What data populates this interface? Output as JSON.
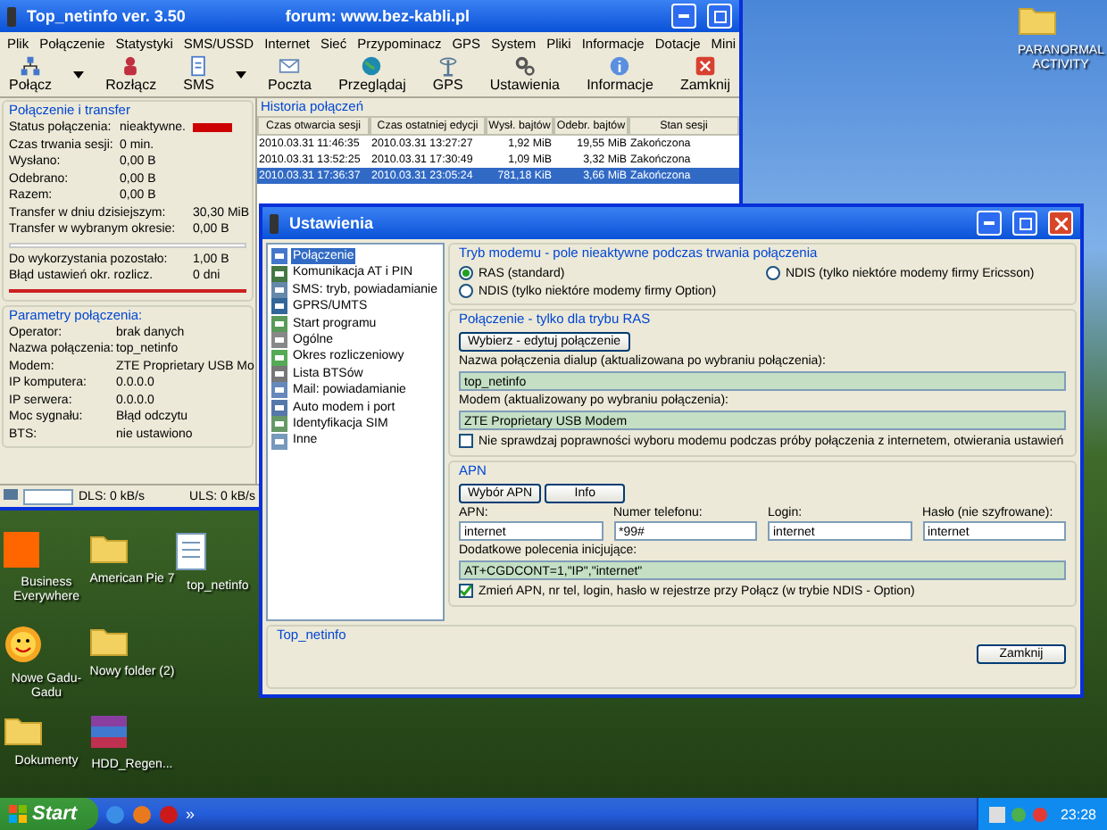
{
  "desktop_icons": [
    {
      "label": "PARANORMAL ACTIVITY",
      "kind": "folder"
    },
    {
      "label": "Business Everywhere",
      "kind": "app"
    },
    {
      "label": "American Pie 7",
      "kind": "folder"
    },
    {
      "label": "top_netinfo",
      "kind": "document"
    },
    {
      "label": "Nowe Gadu-Gadu",
      "kind": "smiley"
    },
    {
      "label": "Nowy folder (2)",
      "kind": "folder"
    },
    {
      "label": "Dokumenty",
      "kind": "folder"
    },
    {
      "label": "HDD_Regen...",
      "kind": "archive"
    }
  ],
  "main_window": {
    "title": "Top_netinfo ver. 3.50",
    "forum": "forum: www.bez-kabli.pl",
    "menu": [
      "Plik",
      "Połączenie",
      "Statystyki",
      "SMS/USSD",
      "Internet",
      "Sieć",
      "Przypominacz",
      "GPS",
      "System",
      "Pliki",
      "Informacje",
      "Dotacje",
      "Mini"
    ],
    "toolbar": [
      {
        "label": "Połącz",
        "dropdown": true
      },
      {
        "label": "Rozłącz",
        "dropdown": false
      },
      {
        "label": "SMS",
        "dropdown": true
      },
      {
        "label": "Poczta",
        "dropdown": false
      },
      {
        "label": "Przeglądaj",
        "dropdown": false
      },
      {
        "label": "GPS",
        "dropdown": false
      },
      {
        "label": "Ustawienia",
        "dropdown": false
      },
      {
        "label": "Informacje",
        "dropdown": false
      },
      {
        "label": "Zamknij",
        "dropdown": false
      }
    ],
    "connection": {
      "title": "Połączenie i transfer",
      "rows": [
        {
          "label": "Status połączenia:",
          "value": "nieaktywne.",
          "color": "#cc0000"
        },
        {
          "label": "Czas trwania sesji:",
          "value": "0 min."
        },
        {
          "label": "Wysłano:",
          "value": "0,00 B"
        },
        {
          "label": "Odebrano:",
          "value": "0,00 B"
        },
        {
          "label": "Razem:",
          "value": "0,00 B"
        },
        {
          "label": "Transfer w dniu dzisiejszym:",
          "value": "30,30 MiB"
        },
        {
          "label": "Transfer w wybranym okresie:",
          "value": "0,00 B"
        }
      ],
      "limit_rows": [
        {
          "label": "Do wykorzystania pozostało:",
          "value": "1,00 B"
        },
        {
          "label": "Błąd ustawień okr. rozlicz.",
          "value": "0 dni"
        }
      ]
    },
    "parameters": {
      "title": "Parametry połączenia:",
      "rows": [
        {
          "label": "Operator:",
          "value": "brak danych"
        },
        {
          "label": "Nazwa połączenia:",
          "value": "top_netinfo"
        },
        {
          "label": "Modem:",
          "value": "ZTE Proprietary USB Mo"
        },
        {
          "label": "IP komputera:",
          "value": "0.0.0.0"
        },
        {
          "label": "IP serwera:",
          "value": "0.0.0.0"
        },
        {
          "label": "Moc sygnału:",
          "value": "Błąd odczytu"
        },
        {
          "label": "BTS:",
          "value": "nie ustawiono"
        }
      ]
    },
    "status_bar": {
      "download": "DLS: 0 kB/s",
      "upload": "ULS: 0 kB/s"
    },
    "history": {
      "title": "Historia połączeń",
      "columns": [
        "Czas otwarcia sesji",
        "Czas ostatniej edycji",
        "Wysł. bajtów",
        "Odebr. bajtów",
        "Stan sesji"
      ],
      "rows": [
        {
          "cells": [
            "2010.03.31 11:46:35",
            "2010.03.31 13:27:27",
            "1,92 MiB",
            "19,55 MiB",
            "Zakończona"
          ],
          "selected": false
        },
        {
          "cells": [
            "2010.03.31 13:52:25",
            "2010.03.31 17:30:49",
            "1,09 MiB",
            "3,32 MiB",
            "Zakończona"
          ],
          "selected": false
        },
        {
          "cells": [
            "2010.03.31 17:36:37",
            "2010.03.31 23:05:24",
            "781,18 KiB",
            "3,66 MiB",
            "Zakończona"
          ],
          "selected": true
        }
      ]
    }
  },
  "settings_dialog": {
    "title": "Ustawienia",
    "tree": [
      {
        "label": "Połączenie",
        "selected": true
      },
      {
        "label": "Komunikacja AT i PIN",
        "selected": false
      },
      {
        "label": "SMS: tryb, powiadamianie",
        "selected": false
      },
      {
        "label": "GPRS/UMTS",
        "selected": false
      },
      {
        "label": "Start programu",
        "selected": false
      },
      {
        "label": "Ogólne",
        "selected": false
      },
      {
        "label": "Okres rozliczeniowy",
        "selected": false
      },
      {
        "label": "Lista BTSów",
        "selected": false
      },
      {
        "label": "Mail: powiadamianie",
        "selected": false
      },
      {
        "label": "Auto modem i port",
        "selected": false
      },
      {
        "label": "Identyfikacja SIM",
        "selected": false
      },
      {
        "label": "Inne",
        "selected": false
      }
    ],
    "mode_group": {
      "title": "Tryb modemu - pole nieaktywne podczas trwania połączenia",
      "options": [
        {
          "label": "RAS (standard)",
          "selected": true
        },
        {
          "label": "NDIS (tylko niektóre modemy firmy Ericsson)",
          "selected": false
        },
        {
          "label": "NDIS (tylko niektóre modemy firmy Option)",
          "selected": false
        }
      ]
    },
    "ras_group": {
      "title": "Połączenie - tylko dla trybu RAS",
      "button": "Wybierz - edytuj połączenie",
      "dialup_label": "Nazwa połączenia dialup (aktualizowana po wybraniu połączenia):",
      "dialup_value": "top_netinfo",
      "modem_label": "Modem (aktualizowany po wybraniu połączenia):",
      "modem_value": "ZTE Proprietary USB Modem",
      "check": {
        "label": "Nie sprawdzaj poprawności wyboru modemu podczas próby połączenia z internetem, otwierania ustawień",
        "checked": false
      }
    },
    "apn_group": {
      "title": "APN",
      "buttons": [
        "Wybór APN",
        "Info"
      ],
      "fields": [
        {
          "label": "APN:",
          "value": "internet"
        },
        {
          "label": "Numer telefonu:",
          "value": "*99#"
        },
        {
          "label": "Login:",
          "value": "internet"
        },
        {
          "label": "Hasło (nie szyfrowane):",
          "value": "internet"
        }
      ],
      "init_label": "Dodatkowe polecenia inicjujące:",
      "init_value": "AT+CGDCONT=1,\"IP\",\"internet\"",
      "check": {
        "label": "Zmień APN, nr tel, login, hasło w rejestrze przy Połącz (w trybie NDIS - Option)",
        "checked": true
      }
    },
    "footer": {
      "title": "Top_netinfo",
      "button": "Zamknij"
    }
  },
  "taskbar": {
    "start": "Start",
    "overflow": "»",
    "clock": "23:28"
  }
}
